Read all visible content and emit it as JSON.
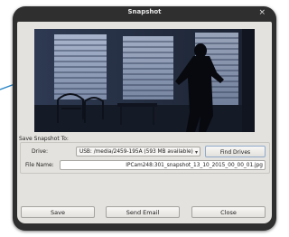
{
  "dialog": {
    "title": "Snapshot",
    "close_glyph": "×"
  },
  "snapshot_image": {
    "description_icon": "surveillance-snapshot-image"
  },
  "save_section": {
    "heading": "Save Snapshot To:",
    "drive_label": "Drive:",
    "drive_selected": "USB: /media/2459-195A (593 MB available)",
    "drive_arrow": "▾",
    "find_drives_label": "Find Drives",
    "file_name_label": "File Name:",
    "file_name_value": "IPCam248:301_snapshot_13_10_2015_00_00_01.jpg"
  },
  "buttons": {
    "save": "Save",
    "send_email": "Send Email",
    "close": "Close"
  },
  "colors": {
    "frame": "#2f2f2f",
    "client": "#e4e2de",
    "pointer": "#2a86c7"
  }
}
